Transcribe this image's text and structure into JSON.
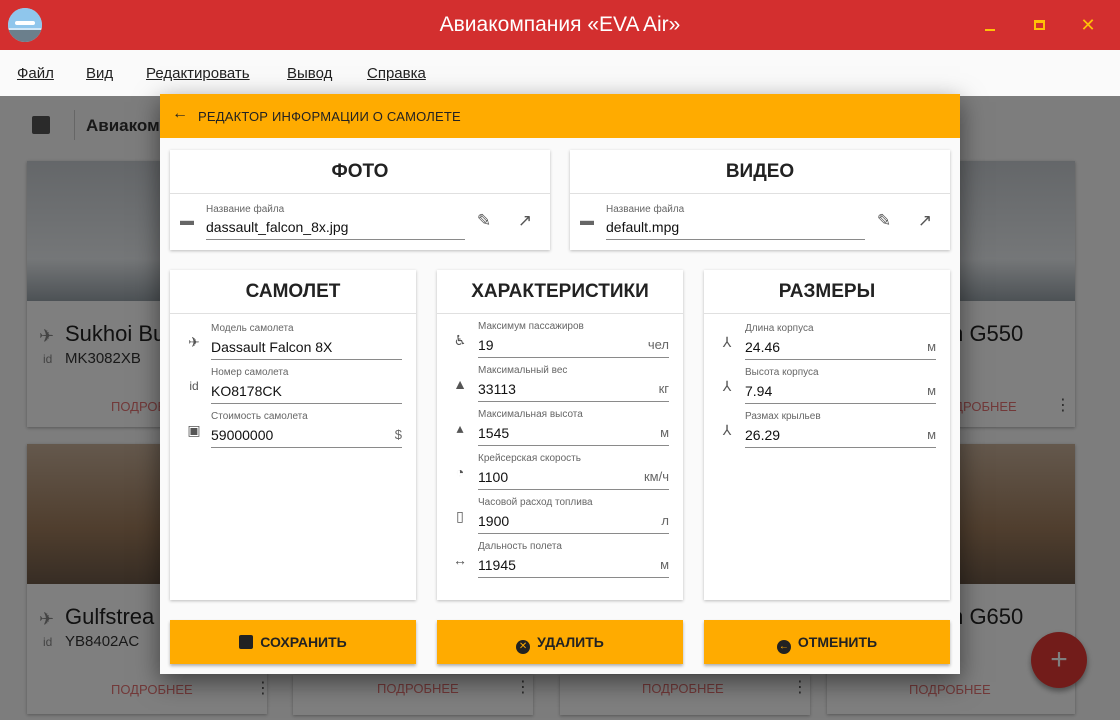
{
  "window": {
    "title": "Авиакомпания «EVA Air»"
  },
  "menu": [
    "Файл",
    "Вид",
    "Редактировать",
    "Вывод",
    "Справка"
  ],
  "background": {
    "toolbar_title": "Авиаком",
    "cards": [
      {
        "name": "Sukhoi Bu",
        "reg": "MK3082XB",
        "more": "ПОДРОБНЕЕ"
      },
      {
        "name": "m G550",
        "more": "ПОДРОБНЕЕ"
      },
      {
        "name": "Gulfstrea",
        "reg": "YB8402AC",
        "more": "ПОДРОБНЕЕ"
      },
      {
        "name": "m G650",
        "more": "ПОДРОБНЕЕ"
      }
    ],
    "more_label": "ПОДРОБНЕЕ"
  },
  "dialog": {
    "title": "РЕДАКТОР ИНФОРМАЦИИ О САМОЛЕТЕ",
    "photo": {
      "title": "ФОТО",
      "label": "Название файла",
      "value": "dassault_falcon_8x.jpg"
    },
    "video": {
      "title": "ВИДЕО",
      "label": "Название файла",
      "value": "default.mpg"
    },
    "plane": {
      "title": "САМОЛЕТ",
      "fields": [
        {
          "label": "Модель самолета",
          "value": "Dassault Falcon 8X",
          "unit": "",
          "icon": "airplane-icon"
        },
        {
          "label": "Номер самолета",
          "value": "KO8178CK",
          "unit": "",
          "icon": "id-icon"
        },
        {
          "label": "Стоимость самолета",
          "value": "59000000",
          "unit": "$",
          "icon": "money-icon"
        }
      ]
    },
    "specs": {
      "title": "ХАРАКТЕРИСТИКИ",
      "fields": [
        {
          "label": "Максимум пассажиров",
          "value": "19",
          "unit": "чел",
          "icon": "seat-icon"
        },
        {
          "label": "Максимальный вес",
          "value": "33113",
          "unit": "кг",
          "icon": "weight-icon"
        },
        {
          "label": "Максимальная высота",
          "value": "1545",
          "unit": "м",
          "icon": "altitude-icon"
        },
        {
          "label": "Крейсерская скорость",
          "value": "1100",
          "unit": "км/ч",
          "icon": "speedometer-icon"
        },
        {
          "label": "Часовой расход топлива",
          "value": "1900",
          "unit": "л",
          "icon": "fuel-icon"
        },
        {
          "label": "Дальность полета",
          "value": "11945",
          "unit": "м",
          "icon": "range-icon"
        }
      ]
    },
    "sizes": {
      "title": "РАЗМЕРЫ",
      "fields": [
        {
          "label": "Длина корпуса",
          "value": "24.46",
          "unit": "м",
          "icon": "axis-icon"
        },
        {
          "label": "Высота корпуса",
          "value": "7.94",
          "unit": "м",
          "icon": "axis-icon"
        },
        {
          "label": "Размах крыльев",
          "value": "26.29",
          "unit": "м",
          "icon": "axis-icon"
        }
      ]
    },
    "buttons": {
      "save": "СОХРАНИТЬ",
      "delete": "УДАЛИТЬ",
      "cancel": "ОТМЕНИТЬ"
    }
  },
  "colors": {
    "titlebar": "#d32f2f",
    "accent": "#ffab00",
    "window_controls": "#ffc107"
  }
}
